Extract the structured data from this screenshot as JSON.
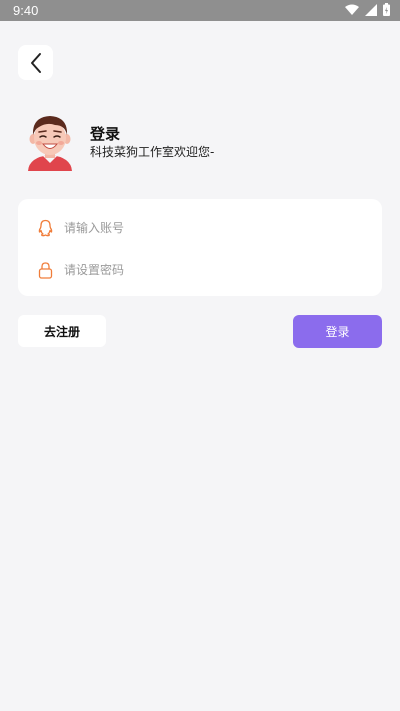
{
  "status_bar": {
    "time": "9:40"
  },
  "header": {
    "title": "登录",
    "subtitle": "科技菜狗工作室欢迎您-"
  },
  "form": {
    "account_placeholder": "请输入账号",
    "account_value": "",
    "password_placeholder": "请设置密码",
    "password_value": ""
  },
  "actions": {
    "register_label": "去注册",
    "login_label": "登录"
  },
  "colors": {
    "accent": "#8b6ced",
    "icon": "#f07d3a",
    "background": "#f5f5f7",
    "status_bar": "#8f8f8f"
  },
  "icons": {
    "back": "chevron-left-icon",
    "account": "qq-icon",
    "password": "lock-icon",
    "wifi": "wifi-icon",
    "signal": "signal-icon",
    "battery": "battery-icon"
  }
}
